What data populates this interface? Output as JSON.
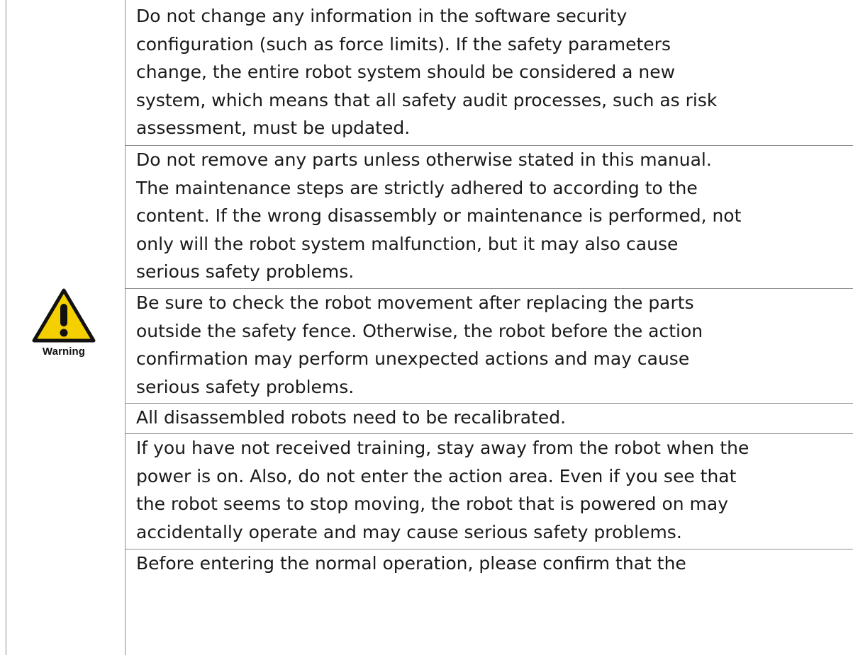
{
  "warning_icon": {
    "name": "warning-triangle-icon",
    "label": "Warning",
    "fill_color": "#f5d000",
    "outline_color": "#111111"
  },
  "rows": [
    {
      "text": "Do not change any information in the software security\nconfiguration (such as force limits). If the safety parameters\nchange, the entire robot system should be considered a new\nsystem, which means that all safety audit processes, such as risk\nassessment, must be updated."
    },
    {
      "text": "Do not remove any parts unless otherwise stated in this manual.\nThe maintenance steps are strictly adhered to according to the\ncontent. If the wrong disassembly or maintenance is performed, not\nonly will the robot system malfunction, but it may also cause\nserious safety problems."
    },
    {
      "text": "Be sure to check the robot movement after replacing the parts\noutside the safety fence. Otherwise, the robot before the action\nconfirmation may perform unexpected actions and may cause\nserious safety problems."
    },
    {
      "text": "All disassembled robots need to be recalibrated."
    },
    {
      "text": "If you have not received training, stay away from the robot when the\npower is on. Also, do not enter the action area. Even if you see that\nthe robot seems to stop moving, the robot that is powered on may\naccidentally operate and may cause serious safety problems."
    },
    {
      "text": "Before entering the normal operation, please confirm that the"
    }
  ]
}
